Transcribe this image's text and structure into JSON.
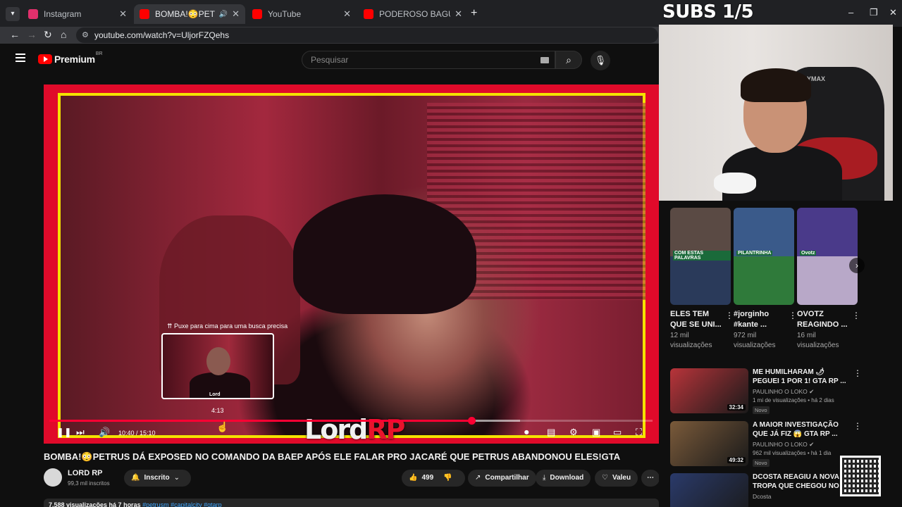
{
  "browser": {
    "tabs": [
      {
        "title": "Instagram",
        "favicon_color": "#e1306c",
        "active": false
      },
      {
        "title": "BOMBA!😳PETRUS DÁ EXP",
        "favicon_color": "#ff0000",
        "active": true
      },
      {
        "title": "YouTube",
        "favicon_color": "#ff0000",
        "active": false
      },
      {
        "title": "PODEROSO BAGUAL RECEBEU",
        "favicon_color": "#ff0000",
        "active": false
      }
    ],
    "url": "youtube.com/watch?v=UljorFZQehs"
  },
  "youtube": {
    "logo_text": "Premium",
    "logo_region": "BR",
    "search_placeholder": "Pesquisar"
  },
  "player": {
    "preview_hint": "⇈ Puxe para cima para uma busca precisa",
    "preview_tag": "Lord",
    "preview_time": "4:13",
    "time": "10:40 / 15:10",
    "progress": 0.7,
    "buffered": 0.78,
    "watermark_a": "Lord",
    "watermark_b": "RP",
    "accent": "#ff0033"
  },
  "video": {
    "title": "BOMBA!😳PETRUS DÁ EXPOSED NO COMANDO DA BAEP APÓS ELE FALAR PRO JACARÉ QUE PETRUS ABANDONOU ELES!GTA",
    "channel": "LORD RP",
    "subscribers": "99,3 mil inscritos",
    "subscribe_label": "Inscrito",
    "likes": "499",
    "share_label": "Compartilhar",
    "download_label": "Download",
    "thanks_label": "Valeu",
    "description_stats": "7.588 visualizações  há 7 horas",
    "description_tags": "#petrusm #capitalcity #gtarp"
  },
  "overlay": {
    "subs_label": "SUBS 1/5",
    "chair_brand": "YMAX"
  },
  "shorts": [
    {
      "title": "ELES TEM QUE SE UNI...",
      "views": "12 mil visualizações",
      "top": "#5a4a44",
      "bottom": "#2a3a5a",
      "label": "COM ESTAS PALAVRAS"
    },
    {
      "title": "#jorginho #kante ...",
      "views": "972 mil visualizações",
      "top": "#3a5a8a",
      "bottom": "#2f7a3a",
      "label": "PILANTRINHA"
    },
    {
      "title": "OVOTZ REAGINDO ...",
      "views": "16 mil visualizações",
      "top": "#4a3a8a",
      "bottom": "#b8a8c8",
      "label": "Ovotz"
    }
  ],
  "recommendations": [
    {
      "title": "ME HUMILHARAM 🌶 PEGUEI 1 POR 1! GTA RP ...",
      "channel": "PAULINHO O LOKO ✔",
      "meta": "1 mi de visualizações • há 2 dias",
      "badge": "Novo",
      "duration": "32:34",
      "color": "#b8343a"
    },
    {
      "title": "A MAIOR INVESTIGAÇÃO QUE JÁ FIZ 😱 GTA RP ...",
      "channel": "PAULINHO O LOKO ✔",
      "meta": "962 mil visualizações • há 1 dia",
      "badge": "Novo",
      "duration": "49:32",
      "color": "#7a5a3a"
    },
    {
      "title": "DCOSTA REAGIU A NOVA TROPA QUE CHEGOU NO ...",
      "channel": "Dcosta",
      "meta": "",
      "badge": "",
      "duration": "",
      "color": "#2a3a6a"
    }
  ]
}
